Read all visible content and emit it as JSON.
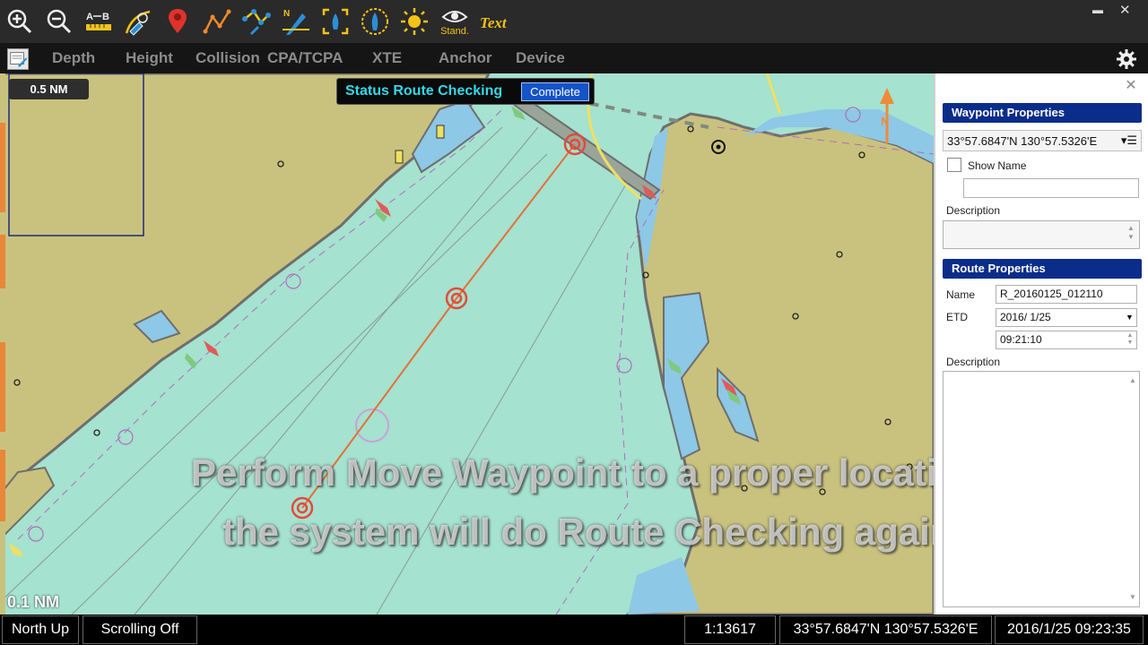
{
  "toolbar": {
    "tools": [
      {
        "name": "zoom-in-icon"
      },
      {
        "name": "zoom-out-icon"
      },
      {
        "name": "measure-ab-icon",
        "label_a": "A",
        "label_b": "B"
      },
      {
        "name": "info-icon"
      },
      {
        "name": "map-marker-icon"
      },
      {
        "name": "route-icon"
      },
      {
        "name": "edit-route-icon"
      },
      {
        "name": "north-ship-icon",
        "label": "N"
      },
      {
        "name": "focus-ship-icon"
      },
      {
        "name": "target-ship-icon"
      },
      {
        "name": "brightness-icon"
      },
      {
        "name": "eye-icon",
        "label": "Stand."
      },
      {
        "name": "text-icon",
        "label": "Text"
      }
    ],
    "minimize_label": "▬",
    "close_label": "✕"
  },
  "menu": {
    "items": [
      "Depth",
      "Height",
      "Collision",
      "CPA/TCPA",
      "XTE",
      "Anchor",
      "Device"
    ]
  },
  "map": {
    "scale_top": "0.5 NM",
    "scale_bottom": "0.1 NM",
    "status_title": "Status Route Checking",
    "status_button": "Complete",
    "north_label": "N",
    "caption_line1": "Perform Move Waypoint to a proper location,",
    "caption_line2": "the system will do Route Checking again.",
    "colors": {
      "land": "#c9c27e",
      "sea_shallow": "#8dc8e6",
      "sea_deep": "#a5e2cf",
      "coast": "#6e6e6e",
      "route": "#e3703a",
      "waypoint": "#e34b3a"
    }
  },
  "panel": {
    "close_label": "✕",
    "waypoint_header": "Waypoint Properties",
    "waypoint_coord": "33°57.6847'N  130°57.5326'E",
    "waypoint_coord_button": "▾☰",
    "show_name_label": "Show Name",
    "waypoint_name_value": "",
    "description_label": "Description",
    "waypoint_description": "",
    "route_header": "Route Properties",
    "name_label": "Name",
    "name_value": "R_20160125_012110",
    "etd_label": "ETD",
    "etd_date": "2016/  1/25",
    "etd_time": "09:21:10",
    "route_description_label": "Description",
    "route_description": ""
  },
  "statusbar": {
    "orientation": "North Up",
    "scrolling": "Scrolling Off",
    "scale": "1:13617",
    "position": "33°57.6847'N  130°57.5326'E",
    "datetime": "2016/1/25 09:23:35"
  }
}
